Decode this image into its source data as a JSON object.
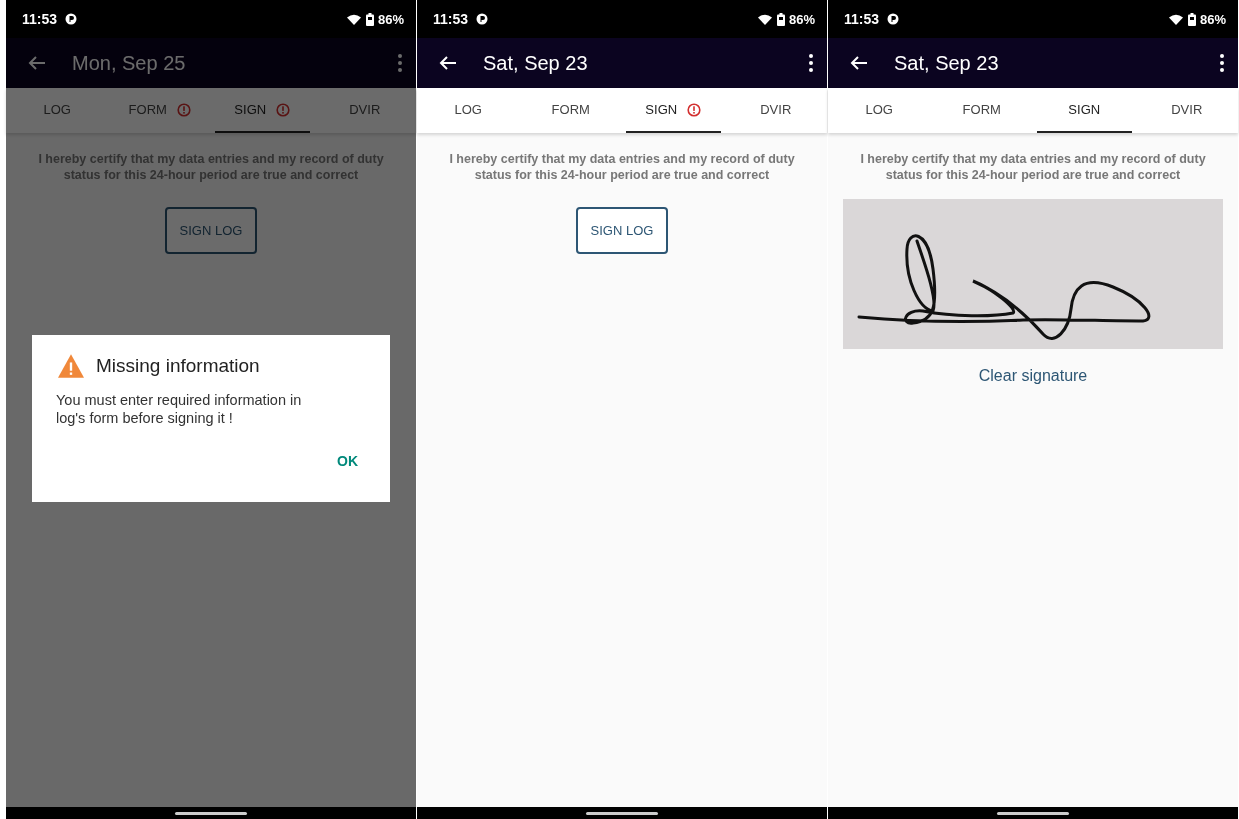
{
  "screens": [
    {
      "status_bar": {
        "time": "11:53",
        "battery": "86%"
      },
      "title": "Mon, Sep 25",
      "tabs": [
        {
          "label": "LOG",
          "selected": false,
          "alert": false
        },
        {
          "label": "FORM",
          "selected": false,
          "alert": true
        },
        {
          "label": "SIGN",
          "selected": true,
          "alert": true
        },
        {
          "label": "DVIR",
          "selected": false,
          "alert": false
        }
      ],
      "certification": "I hereby certify that my data entries and my record of duty status for this 24-hour period are true and correct",
      "kind": "button",
      "sign_button": "SIGN LOG",
      "dialog": {
        "title": "Missing information",
        "message": "You must enter required information in log's form before signing it !",
        "ok": "OK"
      }
    },
    {
      "status_bar": {
        "time": "11:53",
        "battery": "86%"
      },
      "title": "Sat, Sep 23",
      "tabs": [
        {
          "label": "LOG",
          "selected": false,
          "alert": false
        },
        {
          "label": "FORM",
          "selected": false,
          "alert": false
        },
        {
          "label": "SIGN",
          "selected": true,
          "alert": true
        },
        {
          "label": "DVIR",
          "selected": false,
          "alert": false
        }
      ],
      "certification": "I hereby certify that my data entries and my record of duty status for this 24-hour period are true and correct",
      "kind": "button",
      "sign_button": "SIGN LOG"
    },
    {
      "status_bar": {
        "time": "11:53",
        "battery": "86%"
      },
      "title": "Sat, Sep 23",
      "tabs": [
        {
          "label": "LOG",
          "selected": false,
          "alert": false
        },
        {
          "label": "FORM",
          "selected": false,
          "alert": false
        },
        {
          "label": "SIGN",
          "selected": true,
          "alert": false
        },
        {
          "label": "DVIR",
          "selected": false,
          "alert": false
        }
      ],
      "certification": "I hereby certify that my data entries and my record of duty status for this 24-hour period are true and correct",
      "kind": "signature",
      "clear_link": "Clear signature"
    }
  ]
}
